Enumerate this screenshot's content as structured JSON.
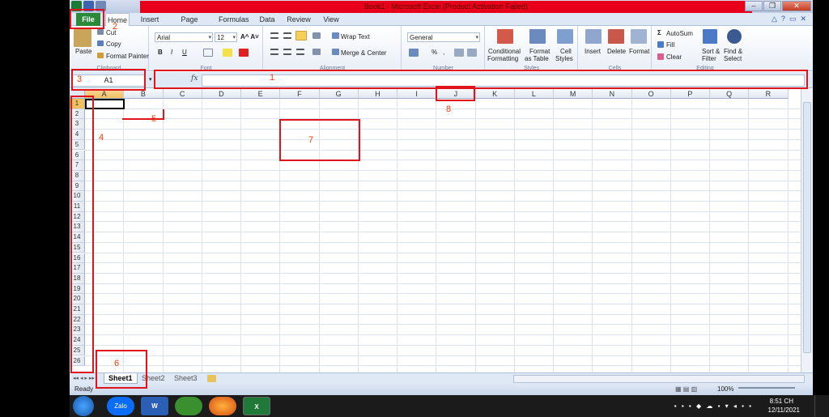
{
  "title": "Book1 - Microsoft Excel (Product Activation Failed)",
  "tabs": {
    "file": "File",
    "items": [
      "Home",
      "Insert",
      "Page Layout",
      "Formulas",
      "Data",
      "Review",
      "View"
    ]
  },
  "ribbon": {
    "clipboard": {
      "paste": "Paste",
      "cut": "Cut",
      "copy": "Copy",
      "format_painter": "Format Painter",
      "label": "Clipboard"
    },
    "font": {
      "family": "Arial",
      "size": "12",
      "bold": "B",
      "italic": "I",
      "underline": "U",
      "label": "Font"
    },
    "alignment": {
      "wrap": "Wrap Text",
      "merge": "Merge & Center",
      "label": "Alignment"
    },
    "number": {
      "format": "General",
      "percent": "%",
      "comma": ",",
      "label": "Number"
    },
    "styles": {
      "conditional": "Conditional",
      "conditional2": "Formatting",
      "format_table": "Format",
      "format_table2": "as Table",
      "cell_styles": "Cell",
      "cell_styles2": "Styles",
      "label": "Styles"
    },
    "cells": {
      "insert": "Insert",
      "delete": "Delete",
      "format": "Format",
      "label": "Cells"
    },
    "editing": {
      "autosum": "AutoSum",
      "fill": "Fill",
      "clear": "Clear",
      "sort": "Sort &",
      "sort2": "Filter",
      "find": "Find &",
      "find2": "Select",
      "label": "Editing"
    }
  },
  "formula_bar": {
    "name_box": "A1",
    "fx": "fx",
    "value": ""
  },
  "columns": [
    "A",
    "B",
    "C",
    "D",
    "E",
    "F",
    "G",
    "H",
    "I",
    "J",
    "K",
    "L",
    "M",
    "N",
    "O",
    "P",
    "Q",
    "R"
  ],
  "rows": [
    "1",
    "2",
    "3",
    "4",
    "5",
    "6",
    "7",
    "8",
    "9",
    "10",
    "11",
    "12",
    "13",
    "14",
    "15",
    "16",
    "17",
    "18",
    "19",
    "20",
    "21",
    "22",
    "23",
    "24",
    "25",
    "26"
  ],
  "sheets": [
    "Sheet1",
    "Sheet2",
    "Sheet3"
  ],
  "status": {
    "ready": "Ready",
    "zoom": "100%"
  },
  "taskbar": {
    "apps": [
      "Zalo",
      "W",
      "",
      "",
      "X"
    ],
    "time": "8:51 CH",
    "date": "12/11/2021"
  },
  "annotations": [
    "1",
    "2",
    "3",
    "4",
    "5",
    "6",
    "7",
    "8"
  ],
  "colors": {
    "annotation": "#e0141a",
    "file_tab": "#2a8a3a",
    "title_bar": "#e8001a"
  }
}
